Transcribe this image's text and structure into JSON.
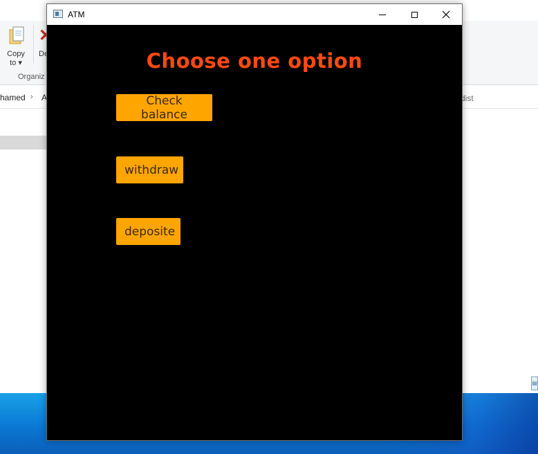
{
  "background_explorer": {
    "copy_label_line1": "Copy",
    "copy_label_line2": "to",
    "delete_label": "De",
    "group_label": "Organiz",
    "breadcrumb_1": "hamed",
    "breadcrumb_2": "A",
    "search_placeholder": "h dist"
  },
  "window": {
    "title": "ATM",
    "controls": {
      "minimize": "minimize",
      "maximize": "maximize",
      "close": "close"
    }
  },
  "atm": {
    "heading": "Choose one option",
    "heading_color": "#ff4a12",
    "button_color": "#ffa500",
    "options": [
      {
        "label": "Check balance"
      },
      {
        "label": "withdraw"
      },
      {
        "label": "deposite"
      }
    ]
  }
}
